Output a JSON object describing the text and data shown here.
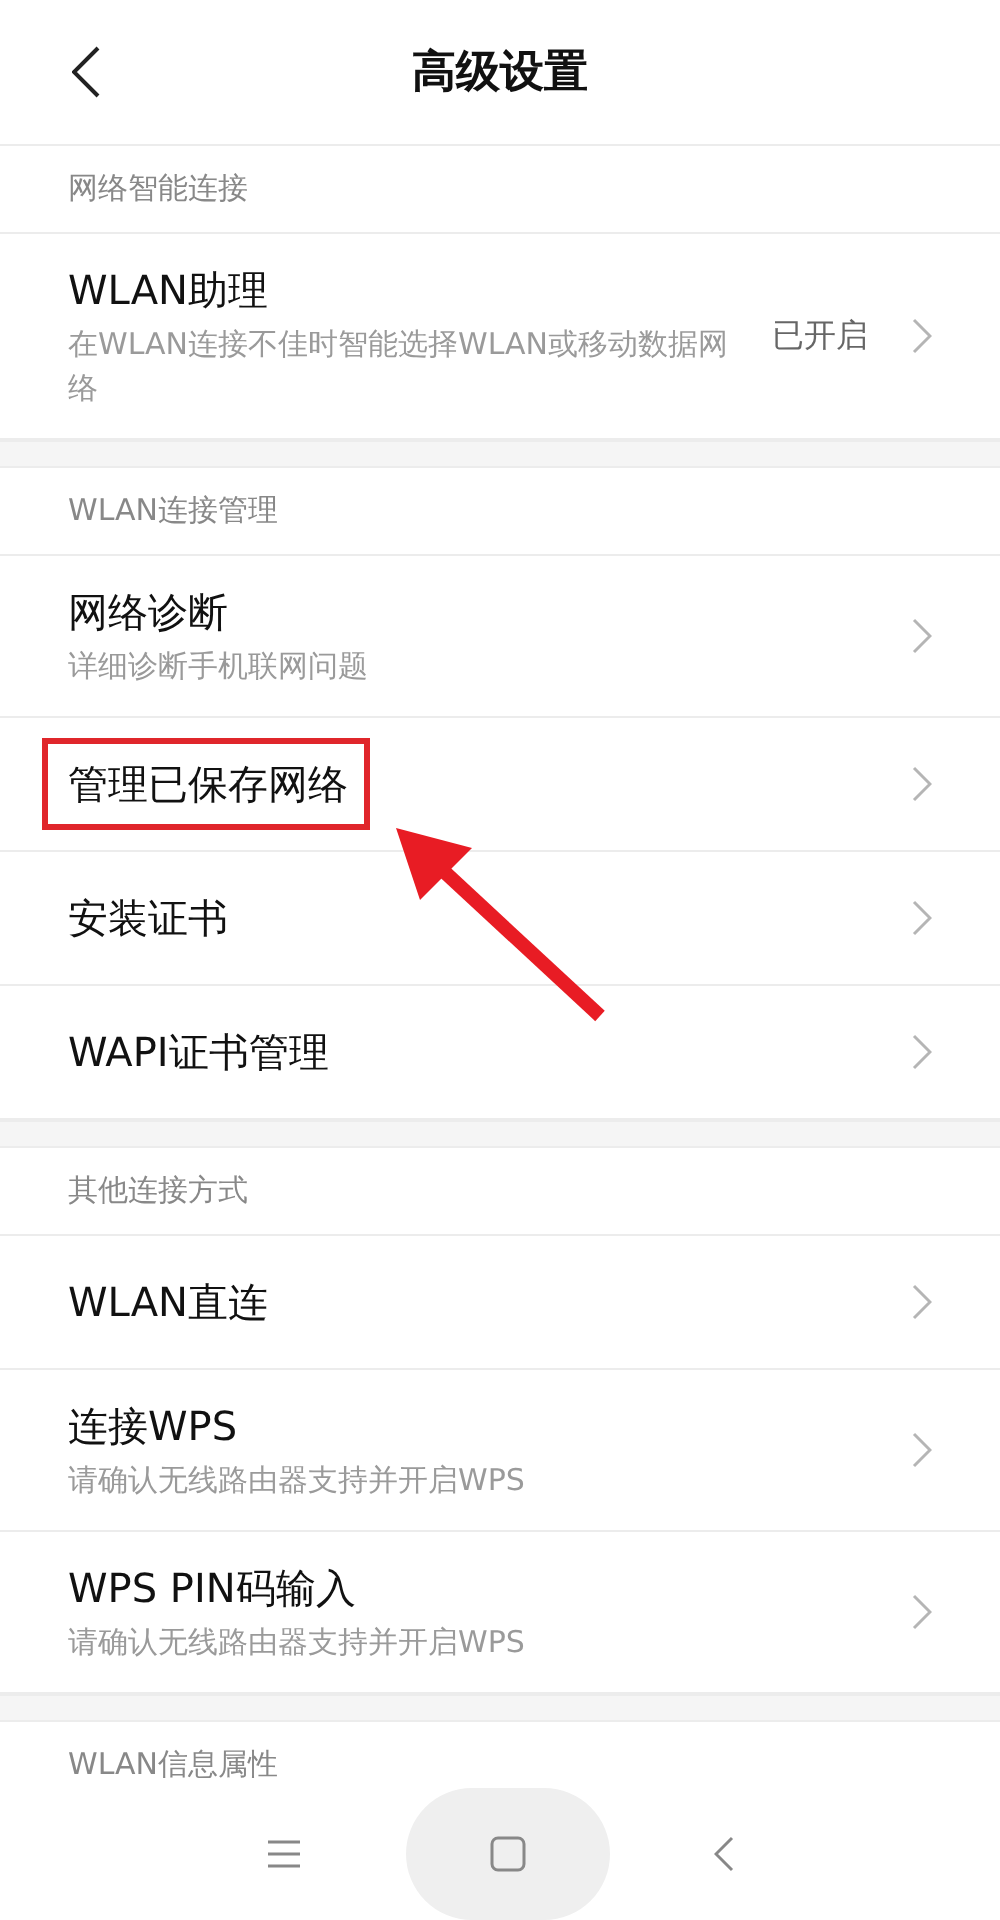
{
  "header": {
    "title": "高级设置"
  },
  "sections": [
    {
      "title": "网络智能连接",
      "items": [
        {
          "title": "WLAN助理",
          "subtitle": "在WLAN连接不佳时智能选择WLAN或移动数据网络",
          "value": "已开启",
          "highlighted": false
        }
      ]
    },
    {
      "title": "WLAN连接管理",
      "items": [
        {
          "title": "网络诊断",
          "subtitle": "详细诊断手机联网问题",
          "highlighted": false
        },
        {
          "title": "管理已保存网络",
          "highlighted": true
        },
        {
          "title": "安装证书",
          "highlighted": false
        },
        {
          "title": "WAPI证书管理",
          "highlighted": false
        }
      ]
    },
    {
      "title": "其他连接方式",
      "items": [
        {
          "title": "WLAN直连",
          "highlighted": false
        },
        {
          "title": "连接WPS",
          "subtitle": "请确认无线路由器支持并开启WPS",
          "highlighted": false
        },
        {
          "title": "WPS PIN码输入",
          "subtitle": "请确认无线路由器支持并开启WPS",
          "highlighted": false
        }
      ]
    },
    {
      "title": "WLAN信息属性"
    }
  ]
}
